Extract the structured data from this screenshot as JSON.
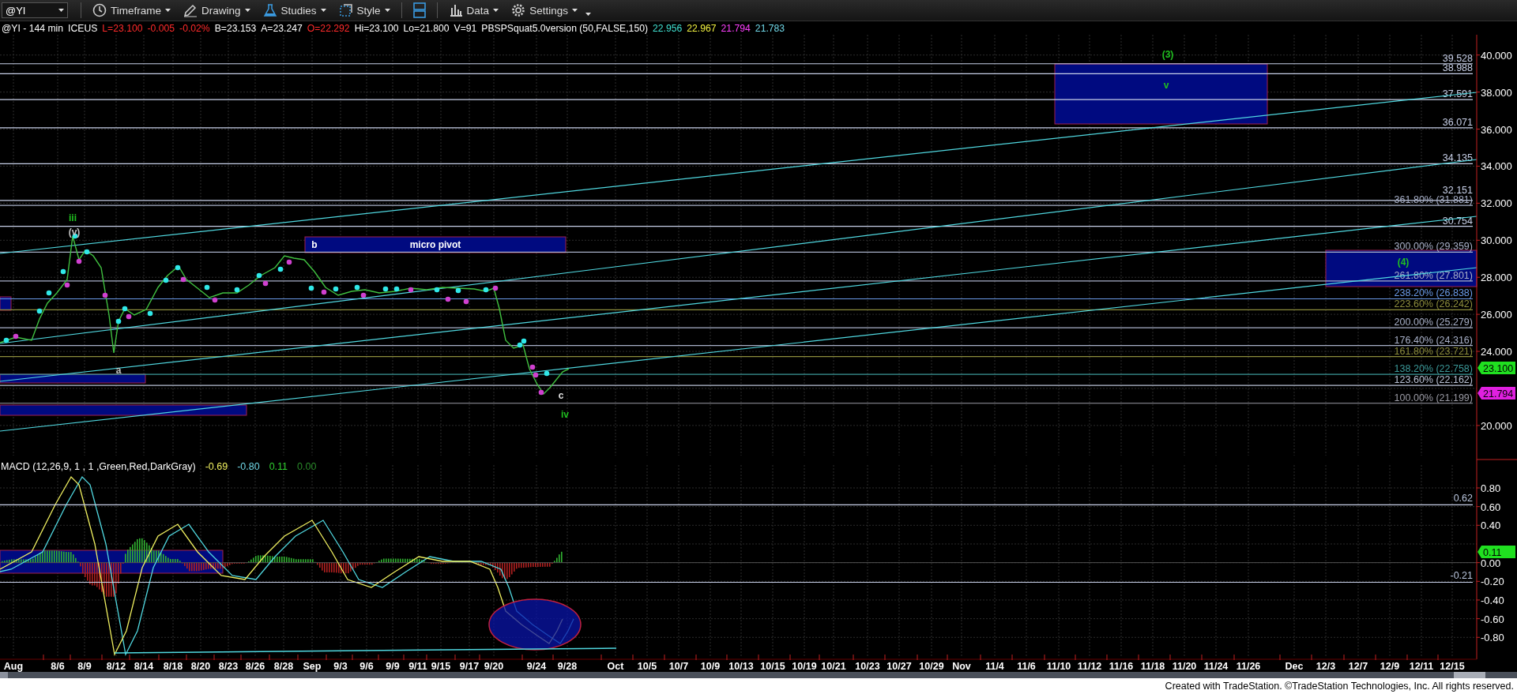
{
  "toolbar": {
    "symbol_field": {
      "value": "@YI"
    },
    "menus_left": [
      {
        "label": "Timeframe"
      },
      {
        "label": "Drawing"
      },
      {
        "label": "Studies"
      },
      {
        "label": "Style"
      }
    ],
    "menus_right": [
      {
        "label": "Data"
      },
      {
        "label": "Settings"
      }
    ]
  },
  "header": [
    {
      "text": "@YI - 144 min",
      "color": "#ffffff"
    },
    {
      "text": "ICEUS",
      "color": "#ffffff"
    },
    {
      "text": "L=23.100",
      "color": "#ff2a2a"
    },
    {
      "text": "-0.005",
      "color": "#ff2a2a"
    },
    {
      "text": "-0.02%",
      "color": "#ff2a2a"
    },
    {
      "text": "B=23.153",
      "color": "#ffffff"
    },
    {
      "text": "A=23.247",
      "color": "#ffffff"
    },
    {
      "text": "O=22.292",
      "color": "#ff2a2a"
    },
    {
      "text": "Hi=23.100",
      "color": "#ffffff"
    },
    {
      "text": "Lo=21.800",
      "color": "#ffffff"
    },
    {
      "text": "V=91",
      "color": "#ffffff"
    },
    {
      "text": "PBSPSquat5.0version (50,FALSE,150)",
      "color": "#ffffff"
    },
    {
      "text": "22.956",
      "color": "#40e0d0"
    },
    {
      "text": "22.967",
      "color": "#f0f040"
    },
    {
      "text": "21.794",
      "color": "#ff40ff"
    },
    {
      "text": "21.783",
      "color": "#70d8e8"
    }
  ],
  "price_panel": {
    "y_ticks": [
      "40.000",
      "38.000",
      "36.000",
      "34.000",
      "32.000",
      "30.000",
      "28.000",
      "26.000",
      "24.000",
      "20.000"
    ],
    "levels": [
      {
        "label": "39.528",
        "color": "#c8d0e8"
      },
      {
        "label": "38.988",
        "color": "#c8d0e8"
      },
      {
        "label": "37.591",
        "color": "#c8d0e8"
      },
      {
        "label": "36.071",
        "color": "#c8d0e8"
      },
      {
        "label": "34.135",
        "color": "#c8d0e8"
      },
      {
        "label": "32.151",
        "color": "#c8d0e8"
      },
      {
        "label": "361.80% (31.881)",
        "color": "#a8b0c8"
      },
      {
        "label": "30.754",
        "color": "#c8d0e8"
      },
      {
        "label": "300.00% (29.359)",
        "color": "#a8b0c8"
      },
      {
        "label": "261.80% (27.801)",
        "color": "#a8b0c8"
      },
      {
        "label": "238.20% (26.838)",
        "color": "#6a9ae8"
      },
      {
        "label": "223.60% (26.242)",
        "color": "#8c8c3c"
      },
      {
        "label": "200.00% (25.279)",
        "color": "#a8b0c8"
      },
      {
        "label": "176.40% (24.316)",
        "color": "#a8b0c8"
      },
      {
        "label": "161.80% (23.721)",
        "color": "#8c8c3c"
      },
      {
        "label": "138.20% (22.758)",
        "color": "#3c9a9a"
      },
      {
        "label": "123.60% (22.162)",
        "color": "#b8c0d4"
      },
      {
        "label": "100.00% (21.199)",
        "color": "#9a9aa4"
      }
    ],
    "wave_labels": [
      {
        "text": "(3)",
        "color": "#20c020"
      },
      {
        "text": "v",
        "color": "#20c020"
      },
      {
        "text": "iii",
        "color": "#20c020"
      },
      {
        "text": "(v)",
        "color": "#c0c0c0"
      },
      {
        "text": "b",
        "color": "#ffffff"
      },
      {
        "text": "micro pivot",
        "color": "#ffffff"
      },
      {
        "text": "a",
        "color": "#c0c0c0"
      },
      {
        "text": "c",
        "color": "#e0e0e0"
      },
      {
        "text": "iv",
        "color": "#20c020"
      },
      {
        "text": "(4)",
        "color": "#20c020"
      }
    ],
    "last_price_tag": "23.100",
    "low_price_tag": "21.794"
  },
  "macd_panel": {
    "label": "MACD (12,26,9, 1 , 1 ,Green,Red,DarkGray)",
    "values": [
      {
        "text": "-0.69",
        "color": "#f0f060"
      },
      {
        "text": "-0.80",
        "color": "#70d8e8"
      },
      {
        "text": "0.11",
        "color": "#30d030"
      },
      {
        "text": "0.00",
        "color": "#2a8a2a"
      }
    ],
    "y_ticks": [
      "0.80",
      "0.60",
      "0.40",
      "0.00",
      "-0.20",
      "-0.40",
      "-0.60",
      "-0.80"
    ],
    "levels": [
      {
        "label": "0.62"
      },
      {
        "label": "-0.21"
      }
    ],
    "value_tag": "0.11"
  },
  "x_axis": [
    "Aug",
    "8/6",
    "8/9",
    "8/12",
    "8/14",
    "8/18",
    "8/20",
    "8/23",
    "8/26",
    "8/28",
    "Sep",
    "9/3",
    "9/6",
    "9/9",
    "9/11",
    "9/15",
    "9/17",
    "9/20",
    "9/24",
    "9/28",
    "Oct",
    "10/5",
    "10/7",
    "10/9",
    "10/13",
    "10/15",
    "10/19",
    "10/21",
    "10/23",
    "10/27",
    "10/29",
    "Nov",
    "11/4",
    "11/6",
    "11/10",
    "11/12",
    "11/16",
    "11/18",
    "11/20",
    "11/24",
    "11/26",
    "Dec",
    "12/3",
    "12/7",
    "12/9",
    "12/11",
    "12/15"
  ],
  "footer": "Created with TradeStation. ©TradeStation Technologies, Inc. All rights reserved."
}
